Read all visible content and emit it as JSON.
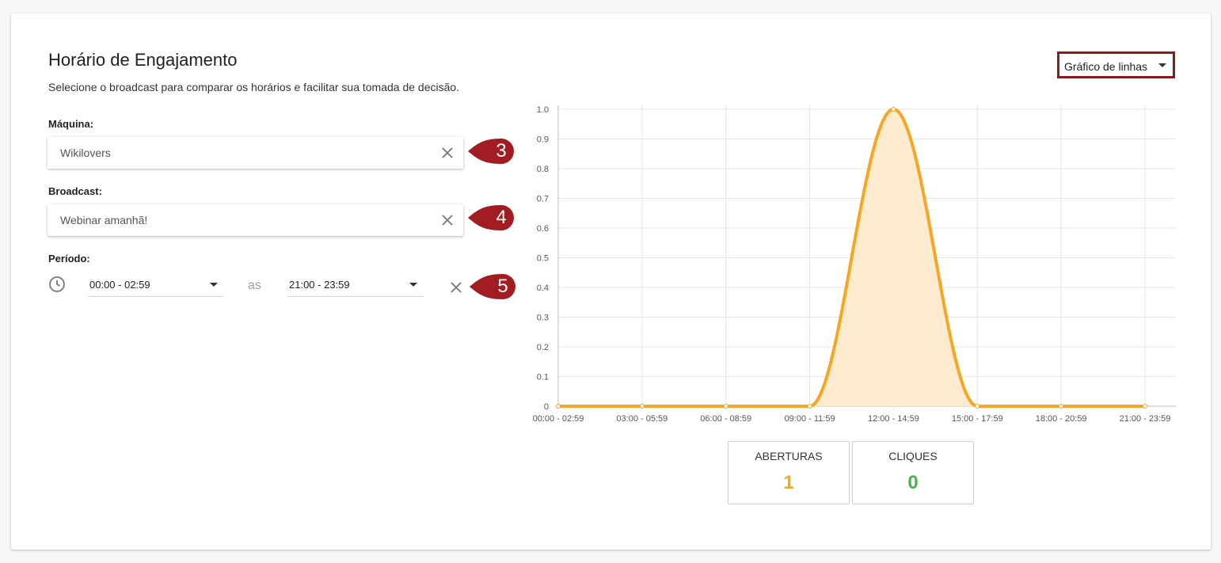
{
  "header": {
    "title": "Horário de Engajamento",
    "subtitle": "Selecione o broadcast para comparar os horários e facilitar sua tomada de decisão."
  },
  "form": {
    "machine": {
      "label": "Máquina:",
      "value": "Wikilovers"
    },
    "broadcast": {
      "label": "Broadcast:",
      "value": "Webinar amanhã!"
    },
    "period": {
      "label": "Período:",
      "start": "00:00 - 02:59",
      "separator": "as",
      "end": "21:00 - 23:59"
    }
  },
  "markers": [
    "3",
    "4",
    "5"
  ],
  "chart_type_select": {
    "value": "Gráfico de linhas"
  },
  "stats": [
    {
      "label": "ABERTURAS",
      "value": "1",
      "color": "#f5a623"
    },
    {
      "label": "CLIQUES",
      "value": "0",
      "color": "#4caf50"
    }
  ],
  "colors": {
    "marker": "#a11d21",
    "line": "#f5a623",
    "fill": "#fdebd0"
  },
  "chart_data": {
    "type": "area",
    "categories": [
      "00:00 - 02:59",
      "03:00 - 05:59",
      "06:00 - 08:59",
      "09:00 - 11:59",
      "12:00 - 14:59",
      "15:00 - 17:59",
      "18:00 - 20:59",
      "21:00 - 23:59"
    ],
    "series": [
      {
        "values": [
          0,
          0,
          0,
          0,
          1,
          0,
          0,
          0
        ]
      }
    ],
    "yticks": [
      "0",
      "0.1",
      "0.2",
      "0.3",
      "0.4",
      "0.5",
      "0.6",
      "0.7",
      "0.8",
      "0.9",
      "1.0"
    ],
    "ylim": [
      0,
      1
    ],
    "grid": true,
    "smooth": true,
    "title": "",
    "xlabel": "",
    "ylabel": ""
  }
}
